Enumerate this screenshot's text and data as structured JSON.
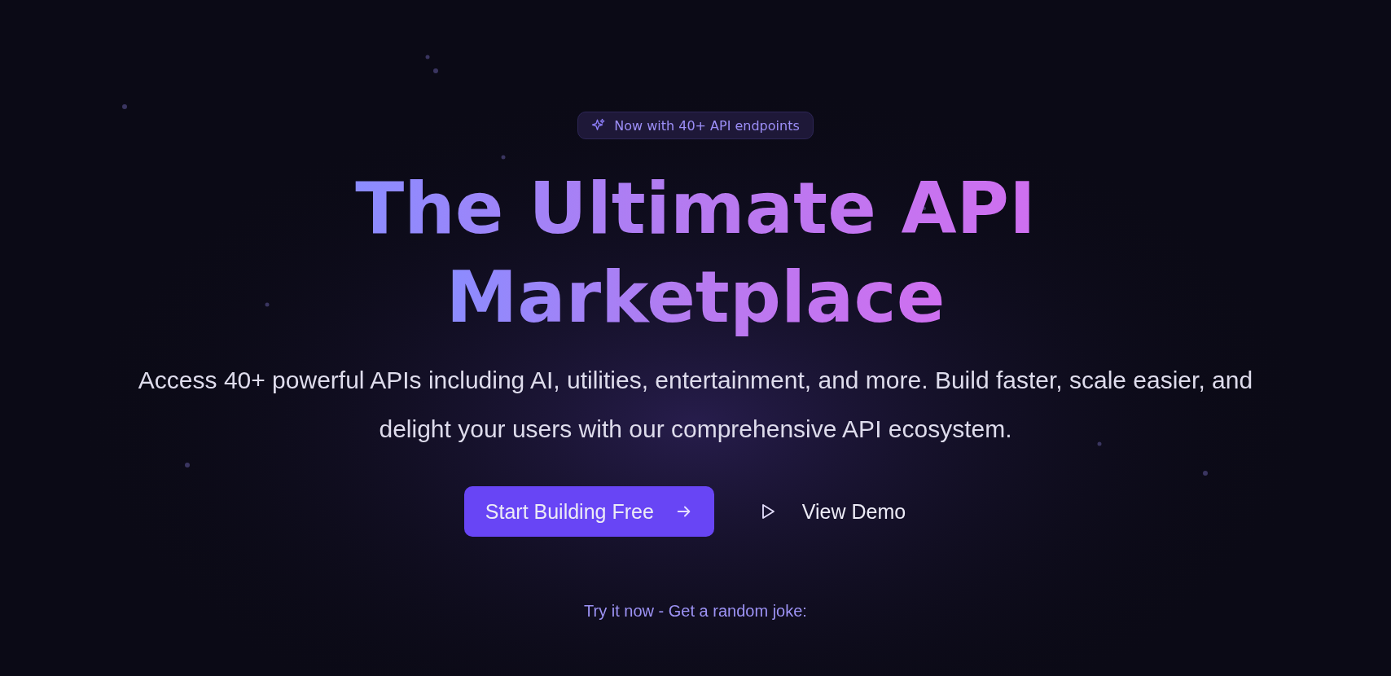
{
  "badge": {
    "text": "Now with 40+ API endpoints"
  },
  "heading": {
    "lines": [
      "The Ultimate API",
      "Marketplace"
    ]
  },
  "description": "Access 40+ powerful APIs including AI, utilities, entertainment, and more. Build faster, scale easier, and delight your users with our comprehensive API ecosystem.",
  "buttons": [
    {
      "kind": "primary",
      "label": "Start Building Free"
    },
    {
      "kind": "secondary",
      "label": "View Demo"
    }
  ],
  "try_prompt": "Try it now - Get a random joke:"
}
